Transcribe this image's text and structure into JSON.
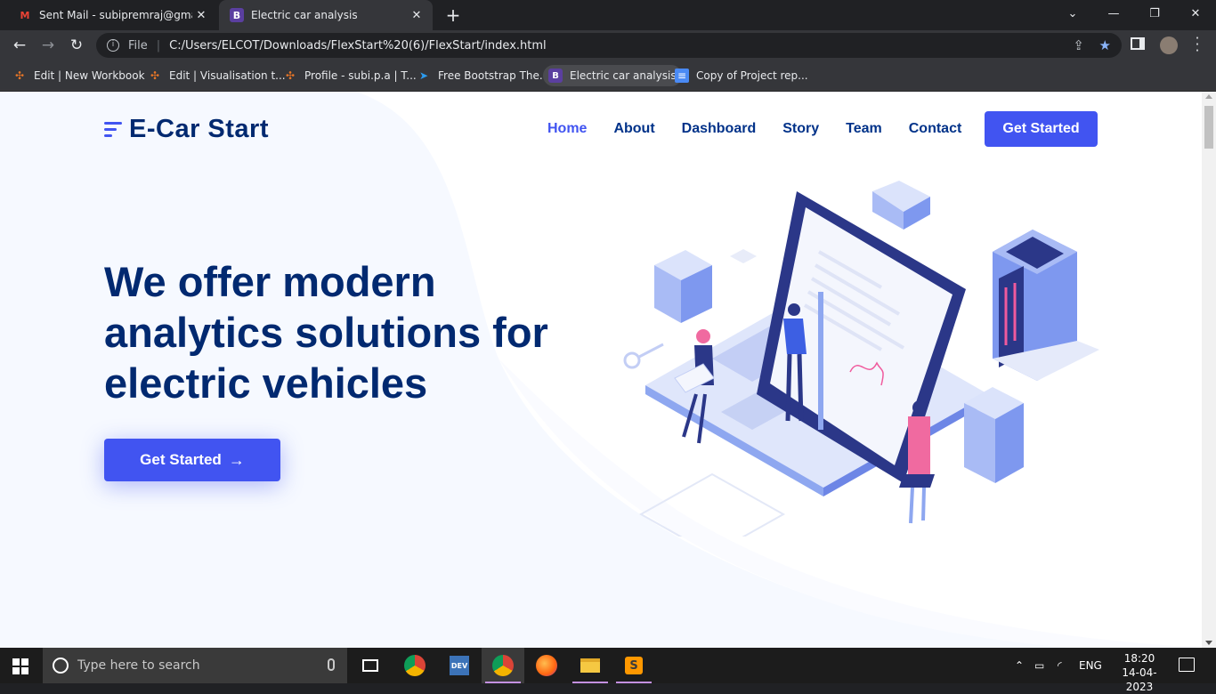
{
  "browser": {
    "tabs": [
      {
        "title": "Sent Mail - subipremraj@gmail.c",
        "favicon": "gmail-icon",
        "active": false
      },
      {
        "title": "Electric car analysis",
        "favicon": "bootstrap-icon",
        "active": true
      }
    ],
    "new_tab_label": "+",
    "url_prefix": "File",
    "url": "C:/Users/ELCOT/Downloads/FlexStart%20(6)/FlexStart/index.html",
    "bookmarks": [
      {
        "label": "Edit | New Workbook",
        "icon": "tableau-icon"
      },
      {
        "label": "Edit | Visualisation t...",
        "icon": "tableau-icon"
      },
      {
        "label": "Profile - subi.p.a | T...",
        "icon": "tableau-icon"
      },
      {
        "label": "Free Bootstrap The...",
        "icon": "bootstrapmade-icon"
      },
      {
        "label": "Electric car analysis",
        "icon": "bootstrap-icon"
      },
      {
        "label": "Copy of Project rep...",
        "icon": "google-docs-icon"
      }
    ]
  },
  "site": {
    "logo": "E-Car Start",
    "nav": [
      {
        "label": "Home",
        "active": true
      },
      {
        "label": "About",
        "active": false
      },
      {
        "label": "Dashboard",
        "active": false
      },
      {
        "label": "Story",
        "active": false
      },
      {
        "label": "Team",
        "active": false
      },
      {
        "label": "Contact",
        "active": false
      }
    ],
    "nav_cta": "Get Started",
    "hero_title": "We offer modern analytics solutions for electric vehicles",
    "hero_cta": "Get Started",
    "colors": {
      "primary": "#4154f1",
      "navy": "#012970",
      "hero_bg": "#f6f9ff"
    }
  },
  "taskbar": {
    "search_placeholder": "Type here to search",
    "language": "ENG",
    "time": "18:20",
    "date": "14-04-2023"
  }
}
